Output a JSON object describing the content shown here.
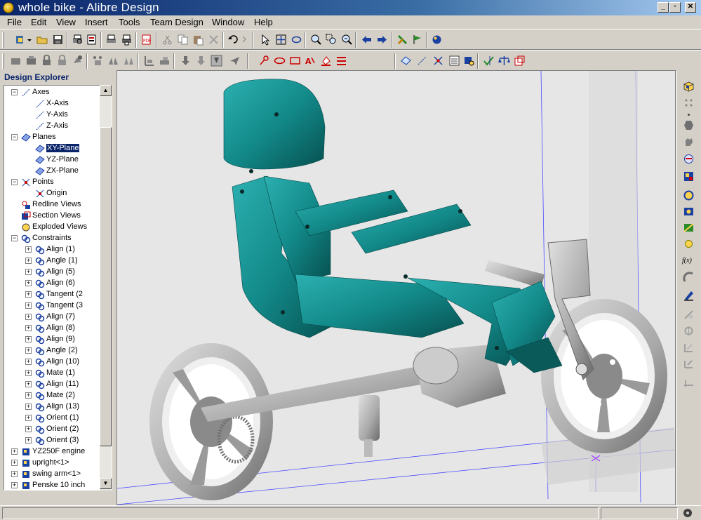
{
  "window": {
    "title": "whole bike - Alibre Design",
    "controls": {
      "minimize": "_",
      "restore": "▫",
      "close": "✕"
    }
  },
  "menubar": {
    "items": [
      "File",
      "Edit",
      "View",
      "Insert",
      "Tools",
      "Team Design",
      "Window",
      "Help"
    ]
  },
  "explorer": {
    "header": "Design Explorer",
    "tree": [
      {
        "label": "Axes",
        "depth": 1,
        "expander": "−",
        "icon": "axes-icon"
      },
      {
        "label": "X-Axis",
        "depth": 2,
        "expander": "",
        "icon": "axis-icon"
      },
      {
        "label": "Y-Axis",
        "depth": 2,
        "expander": "",
        "icon": "axis-icon"
      },
      {
        "label": "Z-Axis",
        "depth": 2,
        "expander": "",
        "icon": "axis-icon"
      },
      {
        "label": "Planes",
        "depth": 1,
        "expander": "−",
        "icon": "planes-icon"
      },
      {
        "label": "XY-Plane",
        "depth": 2,
        "expander": "",
        "icon": "plane-icon",
        "selected": true
      },
      {
        "label": "YZ-Plane",
        "depth": 2,
        "expander": "",
        "icon": "plane-icon"
      },
      {
        "label": "ZX-Plane",
        "depth": 2,
        "expander": "",
        "icon": "plane-icon"
      },
      {
        "label": "Points",
        "depth": 1,
        "expander": "−",
        "icon": "points-icon"
      },
      {
        "label": "Origin",
        "depth": 2,
        "expander": "",
        "icon": "point-icon"
      },
      {
        "label": "Redline Views",
        "depth": 1,
        "expander": "",
        "icon": "redline-icon"
      },
      {
        "label": "Section Views",
        "depth": 1,
        "expander": "",
        "icon": "section-icon"
      },
      {
        "label": "Exploded Views",
        "depth": 1,
        "expander": "",
        "icon": "exploded-icon"
      },
      {
        "label": "Constraints",
        "depth": 1,
        "expander": "−",
        "icon": "constraints-icon"
      },
      {
        "label": "Align (1)",
        "depth": 2,
        "expander": "+",
        "icon": "constraint-icon"
      },
      {
        "label": "Angle (1)",
        "depth": 2,
        "expander": "+",
        "icon": "constraint-icon"
      },
      {
        "label": "Align (5)",
        "depth": 2,
        "expander": "+",
        "icon": "constraint-icon"
      },
      {
        "label": "Align (6)",
        "depth": 2,
        "expander": "+",
        "icon": "constraint-icon"
      },
      {
        "label": "Tangent (2",
        "depth": 2,
        "expander": "+",
        "icon": "constraint-icon"
      },
      {
        "label": "Tangent (3",
        "depth": 2,
        "expander": "+",
        "icon": "constraint-icon"
      },
      {
        "label": "Align (7)",
        "depth": 2,
        "expander": "+",
        "icon": "constraint-icon"
      },
      {
        "label": "Align (8)",
        "depth": 2,
        "expander": "+",
        "icon": "constraint-icon"
      },
      {
        "label": "Align (9)",
        "depth": 2,
        "expander": "+",
        "icon": "constraint-icon"
      },
      {
        "label": "Angle (2)",
        "depth": 2,
        "expander": "+",
        "icon": "constraint-icon"
      },
      {
        "label": "Align (10)",
        "depth": 2,
        "expander": "+",
        "icon": "constraint-icon"
      },
      {
        "label": "Mate (1)",
        "depth": 2,
        "expander": "+",
        "icon": "constraint-icon"
      },
      {
        "label": "Align (11)",
        "depth": 2,
        "expander": "+",
        "icon": "constraint-icon"
      },
      {
        "label": "Mate (2)",
        "depth": 2,
        "expander": "+",
        "icon": "constraint-icon"
      },
      {
        "label": "Align (13)",
        "depth": 2,
        "expander": "+",
        "icon": "constraint-icon"
      },
      {
        "label": "Orient (1)",
        "depth": 2,
        "expander": "+",
        "icon": "constraint-icon"
      },
      {
        "label": "Orient (2)",
        "depth": 2,
        "expander": "+",
        "icon": "constraint-icon"
      },
      {
        "label": "Orient (3)",
        "depth": 2,
        "expander": "+",
        "icon": "constraint-icon"
      },
      {
        "label": "YZ250F engine",
        "depth": 1,
        "expander": "+",
        "icon": "part-icon"
      },
      {
        "label": "upright<1>",
        "depth": 1,
        "expander": "+",
        "icon": "part-icon"
      },
      {
        "label": "swing arm<1>",
        "depth": 1,
        "expander": "+",
        "icon": "part-icon"
      },
      {
        "label": "Penske 10 inch",
        "depth": 1,
        "expander": "+",
        "icon": "part-icon"
      }
    ],
    "scroll_up": "▲",
    "scroll_down": "▼"
  },
  "right_toolbar": {
    "fx_label": "f(x)"
  },
  "colors": {
    "title_dark": "#0a246a",
    "model_teal": "#138a8a",
    "model_grey": "#b4b4b4",
    "viewport_bg": "#e6e6e6"
  }
}
